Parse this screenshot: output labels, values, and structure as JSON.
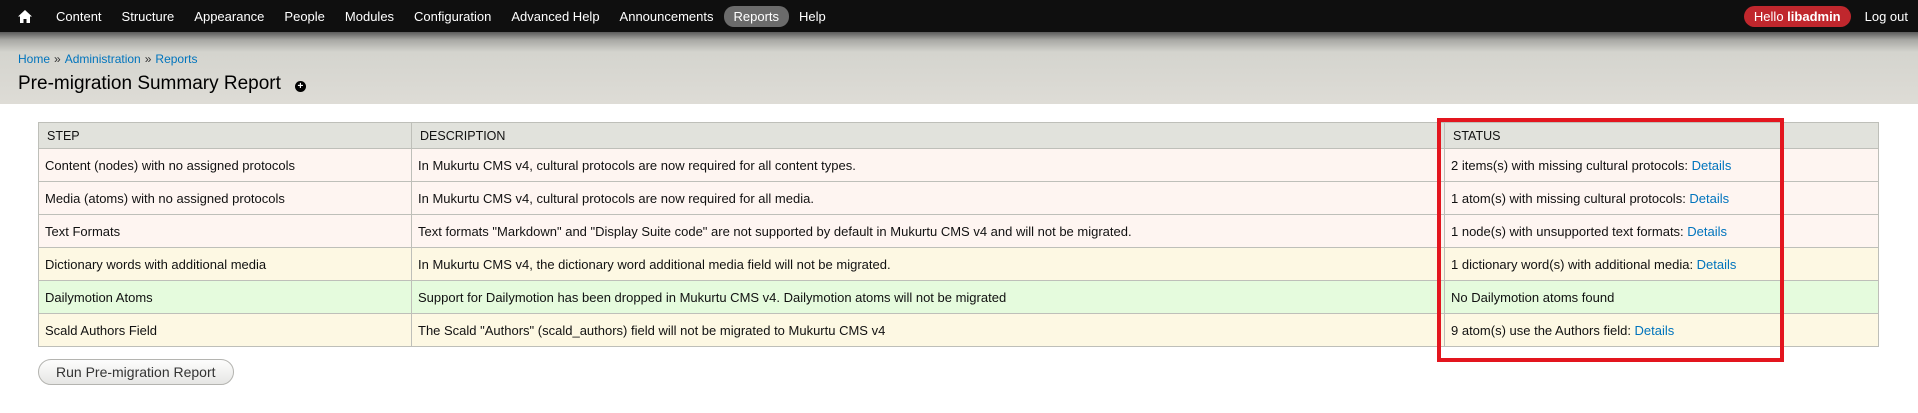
{
  "toolbar": {
    "menu": [
      "Content",
      "Structure",
      "Appearance",
      "People",
      "Modules",
      "Configuration",
      "Advanced Help",
      "Announcements",
      "Reports",
      "Help"
    ],
    "active": "Reports",
    "hello_prefix": "Hello ",
    "username": "libadmin",
    "logout": "Log out"
  },
  "breadcrumb": {
    "items": [
      "Home",
      "Administration",
      "Reports"
    ],
    "separator": "»"
  },
  "page_title": "Pre-migration Summary Report",
  "table": {
    "headers": [
      "STEP",
      "DESCRIPTION",
      "STATUS"
    ],
    "rows": [
      {
        "step": "Content (nodes) with no assigned protocols",
        "description": "In Mukurtu CMS v4, cultural protocols are now required for all content types.",
        "status": "2 items(s) with missing cultural protocols: ",
        "link": "Details",
        "state": "error"
      },
      {
        "step": "Media (atoms) with no assigned protocols",
        "description": "In Mukurtu CMS v4, cultural protocols are now required for all media.",
        "status": "1 atom(s) with missing cultural protocols: ",
        "link": "Details",
        "state": "error"
      },
      {
        "step": "Text Formats",
        "description": "Text formats \"Markdown\" and \"Display Suite code\" are not supported by default in Mukurtu CMS v4 and will not be migrated.",
        "status": "1 node(s) with unsupported text formats: ",
        "link": "Details",
        "state": "error"
      },
      {
        "step": "Dictionary words with additional media",
        "description": "In Mukurtu CMS v4, the dictionary word additional media field will not be migrated.",
        "status": "1 dictionary word(s) with additional media: ",
        "link": "Details",
        "state": "warning"
      },
      {
        "step": "Dailymotion Atoms",
        "description": "Support for Dailymotion has been dropped in Mukurtu CMS v4. Dailymotion atoms will not be migrated",
        "status": "No Dailymotion atoms found",
        "link": "",
        "state": "ok"
      },
      {
        "step": "Scald Authors Field",
        "description": "The Scald \"Authors\" (scald_authors) field will not be migrated to Mukurtu CMS v4",
        "status": "9 atom(s) use the Authors field: ",
        "link": "Details",
        "state": "warning"
      }
    ]
  },
  "run_button": "Run Pre-migration Report",
  "colors": {
    "toolbar_bg": "#0f0f0f",
    "active_pill": "#6b6b6b",
    "hello_badge": "#c0272d",
    "link": "#0074bd",
    "row_error": "#fef5f1",
    "row_warning": "#fdf8e3",
    "row_ok": "#e5fbdd",
    "highlight_box": "#e3151e"
  },
  "icons": {
    "home": "home-icon",
    "add_shortcut": "plus-circle-icon"
  }
}
